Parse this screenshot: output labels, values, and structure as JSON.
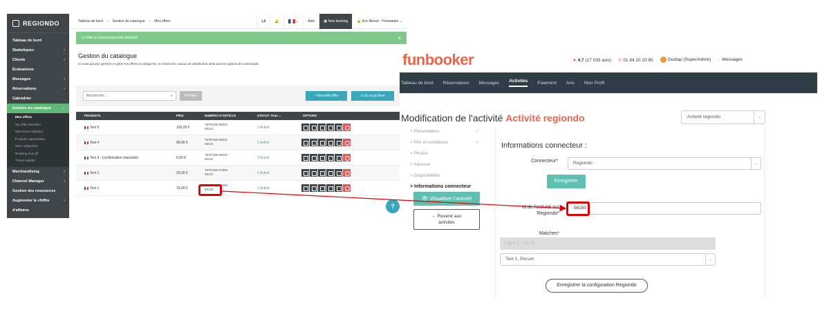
{
  "regiondo": {
    "logo": "REGIONDO",
    "nav": [
      {
        "label": "Tableau de bord",
        "chev": ""
      },
      {
        "label": "Statistiques",
        "chev": "›"
      },
      {
        "label": "Clients",
        "chev": "›"
      },
      {
        "label": "Évaluations",
        "chev": ""
      },
      {
        "label": "Messages",
        "chev": "›"
      },
      {
        "label": "Réservations",
        "chev": "›"
      },
      {
        "label": "Calendrier",
        "chev": ""
      },
      {
        "label": "Gestion du catalogue",
        "chev": "⌄"
      }
    ],
    "subnav": [
      "Mes offres",
      "My Offer Bundles",
      "Mes bons cadeaux",
      "Produits apparentés",
      "Mes catégories",
      "Booking Cut-off",
      "Ticket validity"
    ],
    "nav2": [
      {
        "label": "Merchandising",
        "chev": "›"
      },
      {
        "label": "Channel Manager",
        "chev": "›"
      },
      {
        "label": "Gestion des ressources",
        "chev": ""
      },
      {
        "label": "Augmenter le chiffre d'affaires",
        "chev": "›"
      }
    ],
    "breadcrumb": [
      "Tableau de bord",
      "»",
      "Gestion du catalogue",
      "»",
      "Mes offres"
    ],
    "topbar": {
      "help": "Aide",
      "new_booking": "New booking",
      "user": "Eric Alnouf · Prestataire ⌄"
    },
    "alert": "Le billet a correctement été distribué.",
    "alert_close": "×",
    "page_title": "Gestion du catalogue",
    "page_desc": "Ici vous pouvez générer et gérer les offres et catégories, et choisir les canaux de distribution ainsi que les options de commande.",
    "search_placeholder": "Rechercher...",
    "filter_label": "⇄ Filtrer",
    "btn_new": "+ Nouvelle offre",
    "btn_archive": "⊙ Go to archive",
    "columns": {
      "product": "PRODUITS",
      "price": "PRIX",
      "artno": "NUMÉRO D'ARTICLE",
      "status": "STATUT: Tous ⌄",
      "options": "OPTIONS"
    },
    "rows": [
      {
        "name": "Test 5",
        "price": "100,00 €",
        "art1": "TEFR1B8-58002",
        "art2": "58164",
        "status": "1 Activé"
      },
      {
        "name": "Test 4",
        "price": "90,00 €",
        "art1": "TEFR1B8-58001",
        "art2": "58163",
        "status": "1 Activé"
      },
      {
        "name": "Test 3 - (confirmation manuelle)",
        "price": "5,00 €",
        "art1": "TEFR1B8-58000",
        "art2": "58162",
        "status": "1 Activé"
      },
      {
        "name": "Test 2",
        "price": "20,00 €",
        "art1": "TEFR1B8-57999",
        "art2": "58161",
        "status": "1 Activé"
      },
      {
        "name": "Test 1",
        "price": "10,00 €",
        "art1": "TEFR1B8-57998",
        "art2": "58150",
        "status": "1 Activé"
      }
    ],
    "help_fab": "?"
  },
  "funbooker": {
    "brand": "funbooker",
    "rating": "4.7",
    "rating_count": "(17 033 avis)",
    "phone": "01 84 20 20 85",
    "user": "Guidap (SuperAdmin)",
    "messages": "Messages",
    "nav": [
      "Tableau de bord",
      "Réservations",
      "Messages",
      "Activités",
      "Paiement",
      "Avis",
      "Mon Profil"
    ],
    "title_prefix": "Modification de l'activité",
    "title_activity": "Activité regiondo",
    "activity_select": "Activité regiondo",
    "steps": [
      {
        "label": "> Présentation",
        "check": "✓"
      },
      {
        "label": "> Prix et conditions",
        "check": "✓"
      },
      {
        "label": "> Photos",
        "check": ""
      },
      {
        "label": "> Adresse",
        "check": ""
      },
      {
        "label": "> Disponibilités",
        "check": ""
      },
      {
        "label": "> Informations connecteur",
        "check": ""
      }
    ],
    "btn_view": "👁 Visualiser l'activité",
    "btn_back_1": "← Revenir aux",
    "btn_back_2": "activités",
    "panel_title": "Informations connecteur :",
    "connector_label": "Connecteur*",
    "connector_value": "Regiondo",
    "save": "Enregistrer",
    "regiondo_id_label_1": "Id de l'activité sur",
    "regiondo_id_label_2": "Regiondo*",
    "regiondo_id_value": "58150",
    "matches_label": "Matches*",
    "matches_placeholder": "Ligne 1 - 10.0€",
    "matches_value": "Test 1, Person",
    "config_btn": "Enregistrer la configuration Regiondo"
  },
  "colors": {
    "accent_red": "#e00000",
    "regiondo_green": "#5fb878",
    "funbooker_orange": "#e8654c",
    "teal": "#5fbfb0"
  }
}
